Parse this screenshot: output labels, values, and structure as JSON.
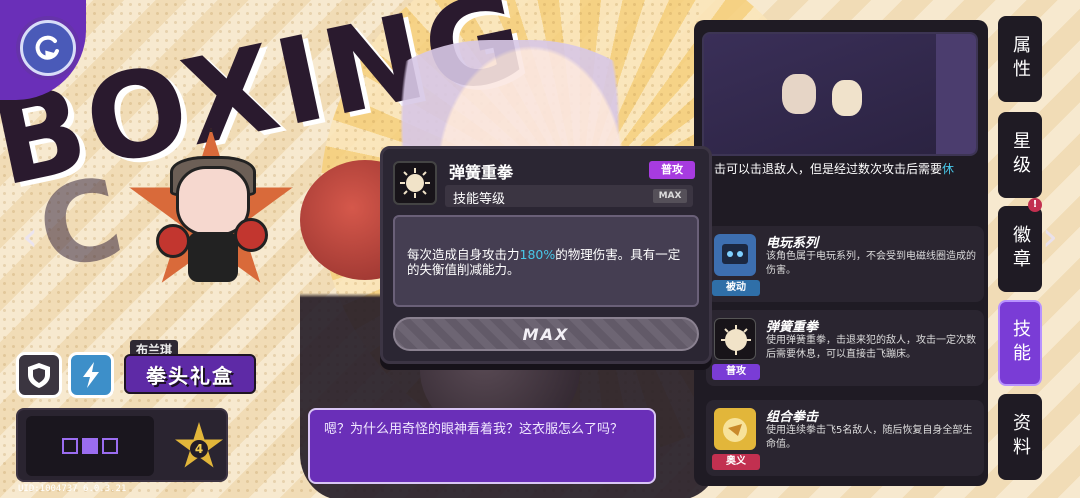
{
  "background": {
    "title_text": "BOXING",
    "title_text2": "C"
  },
  "character": {
    "name_tag": "布兰琪",
    "item_name": "拳头礼盒",
    "rank": "4"
  },
  "dialogue": {
    "text": "嗯？为什么用奇怪的眼神看着我？这衣服怎么了吗？"
  },
  "uid": "UID:1004737 6.0.3.21",
  "popup": {
    "skill_name": "弹簧重拳",
    "type_badge": "普攻",
    "level_label": "技能等级",
    "level_badge": "MAX",
    "desc_prefix": "每次造成自身攻击力",
    "desc_highlight": "180%",
    "desc_suffix": "的物理伤害。具有一定的失衡值削减能力。",
    "max_button": "MAX"
  },
  "right_panel": {
    "desc_line": "击可以击退敌人，但是经过数次攻击后需要",
    "desc_line_highlight": "休",
    "skills": [
      {
        "name": "电玩系列",
        "text": "该角色属于电玩系列，不会受到电磁线圈造成的伤害。",
        "badge": "被动",
        "icon": "gamepad-icon",
        "color": "#3d6fb0"
      },
      {
        "name": "弹簧重拳",
        "text": "使用弹簧重拳，击退来犯的敌人，攻击一定次数后需要休息，可以直接击飞蹦床。",
        "badge": "普攻",
        "icon": "punch-icon",
        "color": "#181419"
      },
      {
        "name": "组合拳击",
        "text": "使用连续拳击飞5名敌人，随后恢复自身全部生命值。",
        "badge": "奥义",
        "icon": "combo-icon",
        "color": "#e2b63a"
      }
    ]
  },
  "tabs": [
    "属性",
    "星级",
    "徽章",
    "技能",
    "资料"
  ],
  "active_tab": "技能",
  "tab_notice": "!"
}
